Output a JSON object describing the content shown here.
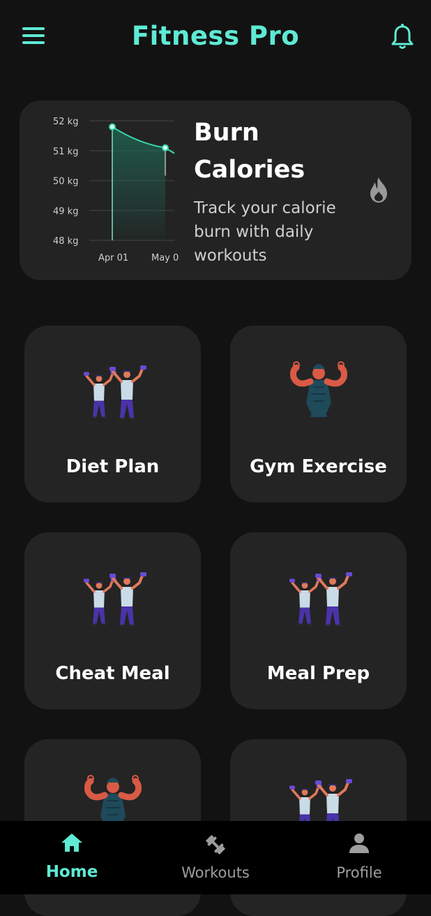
{
  "appbar": {
    "title": "Fitness Pro",
    "menu_icon": "hamburger-menu-icon",
    "bell_icon": "notification-bell-icon"
  },
  "accent": "#5eead4",
  "hero": {
    "title": "Burn Calories",
    "subtitle": "Track your calorie burn with daily workouts",
    "icon": "flame-icon",
    "chart_data": {
      "type": "area",
      "y_ticks": [
        "52 kg",
        "51 kg",
        "50 kg",
        "49 kg",
        "48 kg"
      ],
      "x_ticks": [
        "Apr 01",
        "May 0"
      ],
      "ylim": [
        48,
        52
      ],
      "series": [
        {
          "x": [
            "Apr 01",
            "May 0"
          ],
          "values": [
            51.8,
            51.1
          ]
        }
      ]
    }
  },
  "cards": [
    {
      "label": "Diet Plan",
      "art": "dumbbell-duo-illustration"
    },
    {
      "label": "Gym Exercise",
      "art": "flexing-man-illustration"
    },
    {
      "label": "Cheat Meal",
      "art": "dumbbell-duo-illustration"
    },
    {
      "label": "Meal Prep",
      "art": "dumbbell-duo-illustration"
    },
    {
      "label": "",
      "art": "flexing-man-illustration"
    },
    {
      "label": "",
      "art": "dumbbell-duo-illustration"
    }
  ],
  "nav": [
    {
      "label": "Home",
      "icon": "home-icon",
      "active": true
    },
    {
      "label": "Workouts",
      "icon": "dumbbell-icon",
      "active": false
    },
    {
      "label": "Profile",
      "icon": "person-icon",
      "active": false
    }
  ]
}
